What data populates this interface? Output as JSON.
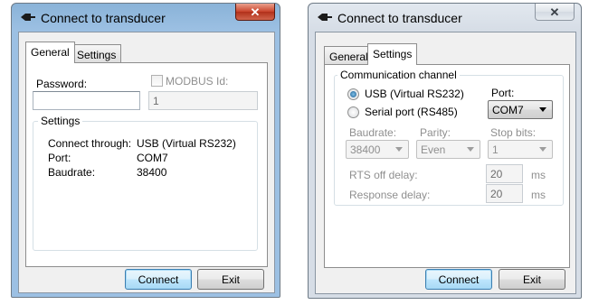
{
  "windows": [
    {
      "title": "Connect to transducer",
      "close_label": "✕",
      "tabs": [
        "General",
        "Settings"
      ],
      "selected_tab": "General",
      "general": {
        "password_label": "Password:",
        "password_value": "",
        "modbus_label": "MODBUS Id:",
        "modbus_value": "1",
        "settings_group": "Settings",
        "rows": [
          {
            "label": "Connect through:",
            "value": "USB (Virtual RS232)"
          },
          {
            "label": "Port:",
            "value": "COM7"
          },
          {
            "label": "Baudrate:",
            "value": "38400"
          }
        ]
      },
      "buttons": {
        "connect": "Connect",
        "exit": "Exit"
      }
    },
    {
      "title": "Connect to transducer",
      "close_label": "✕",
      "tabs": [
        "General",
        "Settings"
      ],
      "selected_tab": "Settings",
      "settings": {
        "group_title": "Communication channel",
        "radio_usb": "USB (Virtual RS232)",
        "radio_serial": "Serial port (RS485)",
        "port_label": "Port:",
        "port_value": "COM7",
        "baudrate_label": "Baudrate:",
        "baudrate_value": "38400",
        "parity_label": "Parity:",
        "parity_value": "Even",
        "stopbits_label": "Stop bits:",
        "stopbits_value": "1",
        "rts_label": "RTS off delay:",
        "rts_value": "20",
        "rts_unit": "ms",
        "response_label": "Response delay:",
        "response_value": "20",
        "response_unit": "ms"
      },
      "buttons": {
        "connect": "Connect",
        "exit": "Exit"
      }
    }
  ]
}
